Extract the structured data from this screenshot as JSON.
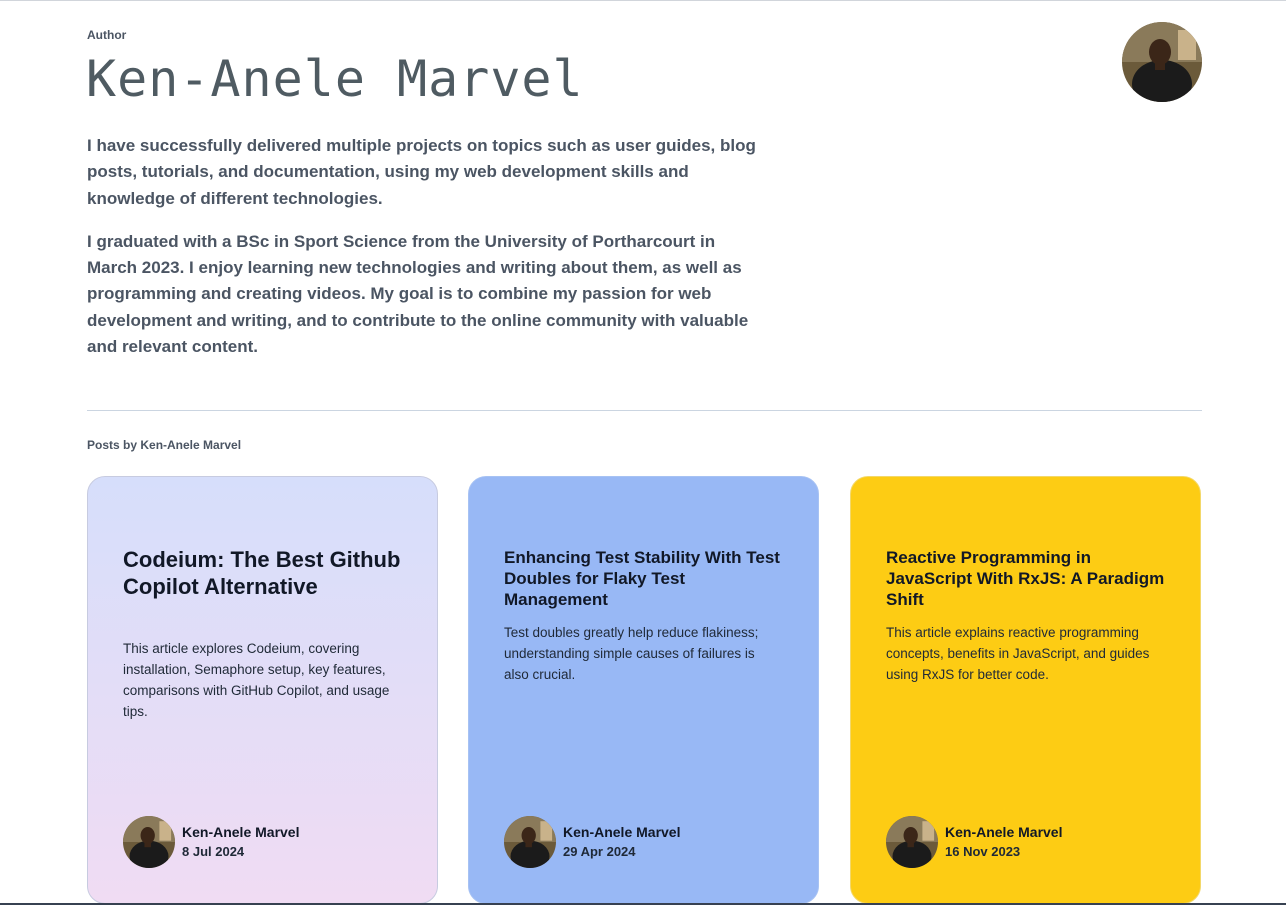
{
  "author": {
    "label": "Author",
    "name": "Ken-Anele Marvel",
    "bio": [
      "I have successfully delivered multiple projects on topics such as user guides, blog posts, tutorials, and documentation, using my web development skills and knowledge of different technologies.",
      "I graduated with a BSc in Sport Science from the University of Portharcourt in March 2023. I enjoy learning new technologies and writing about them, as well as programming and creating videos. My goal is to combine my passion for web development and writing, and to contribute to the online community with valuable and relevant content."
    ]
  },
  "posts": {
    "label": "Posts by Ken-Anele Marvel",
    "items": [
      {
        "title": "Codeium: The Best Github Copilot Alternative",
        "description": "This article explores Codeium, covering installation, Semaphore setup, key features, comparisons with GitHub Copilot, and usage tips.",
        "author": "Ken-Anele Marvel",
        "date": "8 Jul 2024",
        "color": "#d6defb"
      },
      {
        "title": "Enhancing Test Stability With Test Doubles for Flaky Test Management",
        "description": "Test doubles greatly help reduce flakiness; understanding simple causes of failures is also crucial.",
        "author": "Ken-Anele Marvel",
        "date": "29 Apr 2024",
        "color": "#98b8f5"
      },
      {
        "title": "Reactive Programming in JavaScript With RxJS: A Paradigm Shift",
        "description": "This article explains reactive programming concepts, benefits in JavaScript, and guides using RxJS for better code.",
        "author": "Ken-Anele Marvel",
        "date": "16 Nov 2023",
        "color": "#fdcc14"
      }
    ]
  },
  "icons": {
    "avatar": "author-photo"
  }
}
